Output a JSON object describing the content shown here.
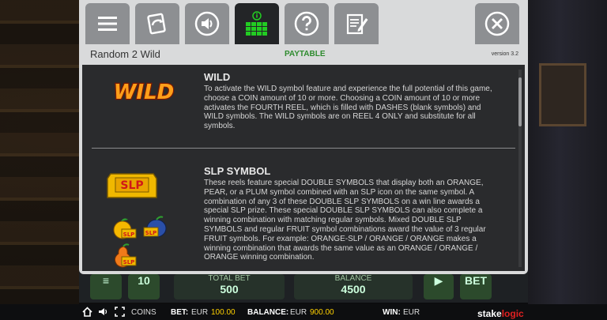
{
  "header": {
    "game_title": "Random 2 Wild",
    "center_label": "PAYTABLE",
    "version": "version 3.2"
  },
  "tabs": [
    {
      "name": "menu"
    },
    {
      "name": "autoplay"
    },
    {
      "name": "sound"
    },
    {
      "name": "paytable",
      "active": true
    },
    {
      "name": "help"
    },
    {
      "name": "history"
    }
  ],
  "sections": {
    "wild": {
      "title": "WILD",
      "logo_text": "WILD",
      "body": "To activate the WILD symbol feature and experience the full potential of this game, choose a COIN amount of 10 or more. Choosing a COIN amount of 10 or more activates the FOURTH REEL, which is filled with DASHES (blank symbols) and WILD symbols. The WILD symbols are on REEL 4 ONLY and substitute for all symbols."
    },
    "slp": {
      "title": "SLP SYMBOL",
      "logo_text": "SLP",
      "badge_text": "SLP",
      "body": "These reels feature special DOUBLE SYMBOLS that display both an ORANGE, PEAR, or a PLUM symbol combined with an SLP icon on the same symbol. A combination of any 3 of these DOUBLE SLP SYMBOLS on a win line awards a special SLP prize. These special DOUBLE SLP SYMBOLS can also complete a winning combination with matching regular symbols. Mixed DOUBLE SLP SYMBOLS and regular FRUIT symbol combinations award the value of 3 regular FRUIT symbols. For example: ORANGE-SLP / ORANGE / ORANGE makes a winning combination that awards the same value as an ORANGE / ORANGE / ORANGE winning combination."
    }
  },
  "game_bar": {
    "lines": "10",
    "total_bet_label": "TOTAL BET",
    "total_bet_value": "500",
    "balance_label": "BALANCE",
    "balance_value": "4500",
    "max_bet_label": "BET"
  },
  "status_bar": {
    "coins_label": "COINS",
    "bet_label": "BET:",
    "bet_currency": "EUR",
    "bet_value": "100.00",
    "balance_label": "BALANCE:",
    "balance_currency": "EUR",
    "balance_value": "900.00",
    "win_label": "WIN:",
    "win_currency": "EUR",
    "brand_a": "stake",
    "brand_b": "logic"
  },
  "colors": {
    "accent_green": "#2e8b2e",
    "status_yellow": "#ffd000",
    "panel_dark": "#2a2b2d"
  }
}
